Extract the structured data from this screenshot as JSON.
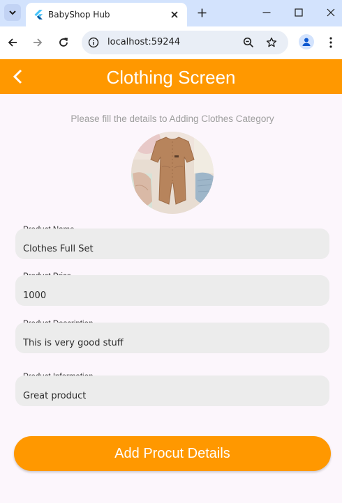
{
  "browser": {
    "tab_title": "BabyShop Hub",
    "url": "localhost:59244",
    "icons": [
      "tab-search-icon",
      "flutter-favicon-icon",
      "close-icon",
      "plus-icon",
      "minimize-icon",
      "maximize-icon",
      "close-window-icon",
      "back-arrow-icon",
      "forward-arrow-icon",
      "reload-icon",
      "site-info-icon",
      "zoom-icon",
      "star-icon",
      "profile-icon",
      "kebab-menu-icon"
    ]
  },
  "app": {
    "title": "Clothing Screen",
    "accent_color": "#ff9800",
    "background_color": "#fcf6fc"
  },
  "form": {
    "subtitle": "Please fill the details to Adding Clothes Category",
    "fields": [
      {
        "label": "Product Name",
        "value": "Clothes Full Set"
      },
      {
        "label": "Product Price",
        "value": "1000"
      },
      {
        "label": "Product Description",
        "value": "This is very good stuff"
      },
      {
        "label": "Product Information",
        "value": "Great product"
      }
    ],
    "submit_label": "Add Procut Details"
  }
}
